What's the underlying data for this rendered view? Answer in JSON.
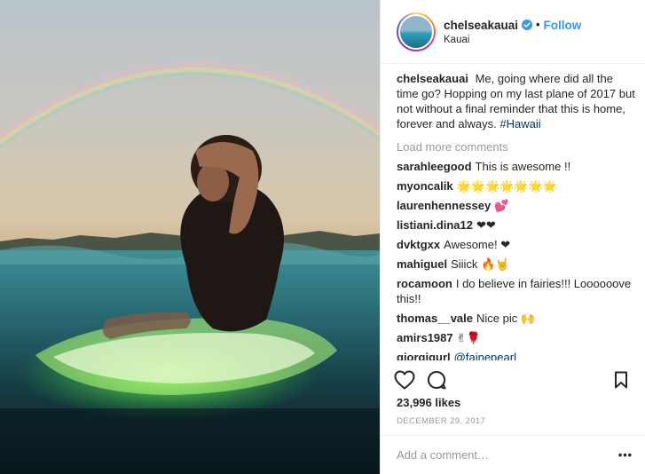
{
  "post": {
    "photo_alt": "",
    "author": {
      "username": "chelseakauai",
      "verified": true,
      "follow_label": "Follow",
      "separator": "•",
      "location": "Kauai"
    },
    "caption": {
      "username": "chelseakauai",
      "text": "Me, going where did all the time go? Hopping on my last plane of 2017 but not without a final reminder that this is home, forever and always.",
      "hashtag": "#Hawaii"
    },
    "load_more_label": "Load more comments",
    "comments": [
      {
        "username": "sarahleegood",
        "text": "This is awesome !!"
      },
      {
        "username": "myoncalik",
        "text": "🌟🌟🌟🌟🌟🌟🌟"
      },
      {
        "username": "laurenhennessey",
        "text": "💕"
      },
      {
        "username": "listiani.dina12",
        "text": "❤❤"
      },
      {
        "username": "dvktgxx",
        "text": "Awesome! ❤"
      },
      {
        "username": "mahiguel",
        "text": "Siiick 🔥🤘"
      },
      {
        "username": "rocamoon",
        "text": "I do believe in fairies!!! Loooooove this!!"
      },
      {
        "username": "thomas__vale",
        "text": "Nice pic 🙌"
      },
      {
        "username": "amirs1987",
        "text": "✌🌹"
      },
      {
        "username": "giorgigurl",
        "text": "",
        "mention": "@fainepearl"
      }
    ],
    "likes": "23,996 likes",
    "date": "DECEMBER 29, 2017",
    "add_comment_placeholder": "Add a comment…",
    "more_label": "•••",
    "icons": {
      "like": "heart-icon",
      "comment": "speech-bubble-icon",
      "save": "bookmark-icon",
      "verified": "verified-badge-icon"
    },
    "colors": {
      "link": "#3897f0",
      "hashtag": "#003569",
      "muted": "#999999",
      "text": "#262626",
      "verified": "#3897f0"
    }
  }
}
